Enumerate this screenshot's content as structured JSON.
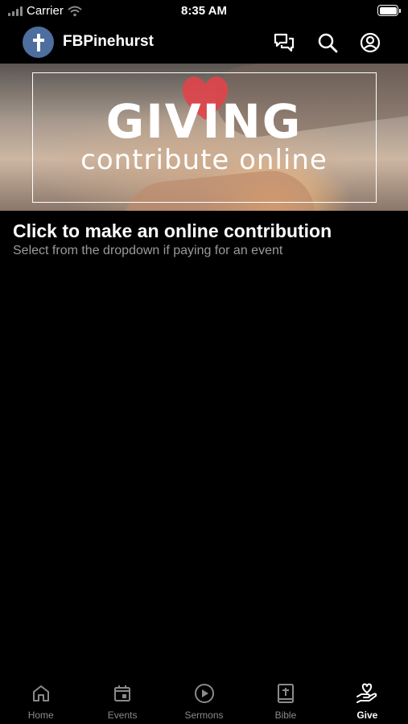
{
  "status_bar": {
    "carrier": "Carrier",
    "time": "8:35 AM"
  },
  "header": {
    "title": "FBPinehurst"
  },
  "banner": {
    "title": "GIVING",
    "subtitle": "contribute online"
  },
  "content": {
    "title": "Click to make an online contribution",
    "subtitle": "Select from the dropdown if paying for an event"
  },
  "tabs": [
    {
      "label": "Home",
      "icon": "home-icon"
    },
    {
      "label": "Events",
      "icon": "calendar-icon"
    },
    {
      "label": "Sermons",
      "icon": "play-circle-icon"
    },
    {
      "label": "Bible",
      "icon": "bible-icon"
    },
    {
      "label": "Give",
      "icon": "give-hand-heart-icon",
      "active": true
    }
  ],
  "colors": {
    "background": "#000000",
    "avatar": "#4d6e9e",
    "inactive_tab": "#8a8a8a"
  }
}
